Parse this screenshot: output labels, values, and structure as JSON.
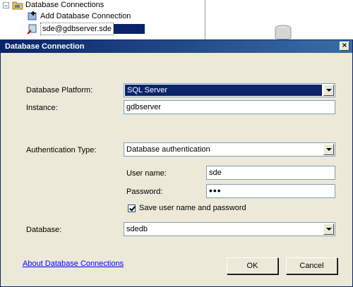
{
  "tree": {
    "root_label": "Database Connections",
    "add_label": "Add Database Connection",
    "selected_label": "sde@gdbserver.sde"
  },
  "dialog": {
    "title": "Database Connection",
    "close_glyph": "×",
    "platform": {
      "label": "Database Platform:",
      "value": "SQL Server"
    },
    "instance": {
      "label": "Instance:",
      "value": "gdbserver"
    },
    "auth": {
      "label": "Authentication Type:",
      "value": "Database authentication"
    },
    "username": {
      "label": "User name:",
      "value": "sde"
    },
    "password": {
      "label": "Password:",
      "masked": "•••"
    },
    "save_credentials": {
      "label": "Save user name and password",
      "checked": true
    },
    "database": {
      "label": "Database:",
      "value": "sdedb"
    },
    "about_link": "About Database Connections",
    "ok_label": "OK",
    "cancel_label": "Cancel"
  }
}
